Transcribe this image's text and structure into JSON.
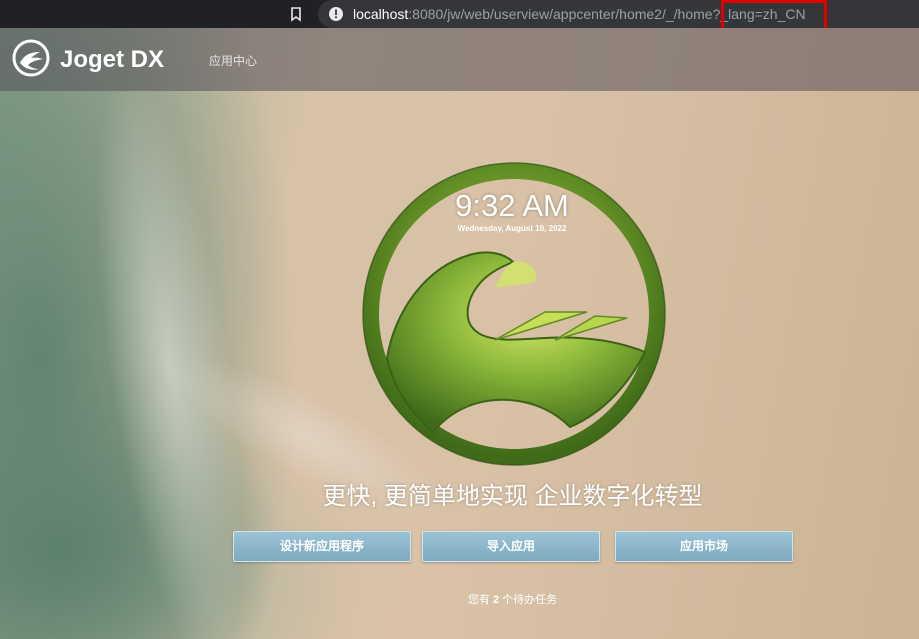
{
  "browser": {
    "url_host": "localhost",
    "url_path": ":8080/jw/web/userview/appcenter/home2/_/home",
    "url_query": "?_lang=zh_CN"
  },
  "header": {
    "brand_name": "Joget DX",
    "nav_app_center": "应用中心"
  },
  "hero": {
    "time": "9:32 AM",
    "date": "Wednesday, August 10, 2022",
    "tagline": "更快, 更简单地实现 企业数字化转型"
  },
  "actions": {
    "design_app": "设计新应用程序",
    "import_app": "导入应用",
    "marketplace": "应用市场"
  },
  "tasks": {
    "prefix": "您有",
    "count": "2",
    "suffix": "个待办任务"
  },
  "colors": {
    "highlight_box": "#e00000",
    "button_fill": "#8fb6cb",
    "logo_green": "#6f9a2a"
  }
}
